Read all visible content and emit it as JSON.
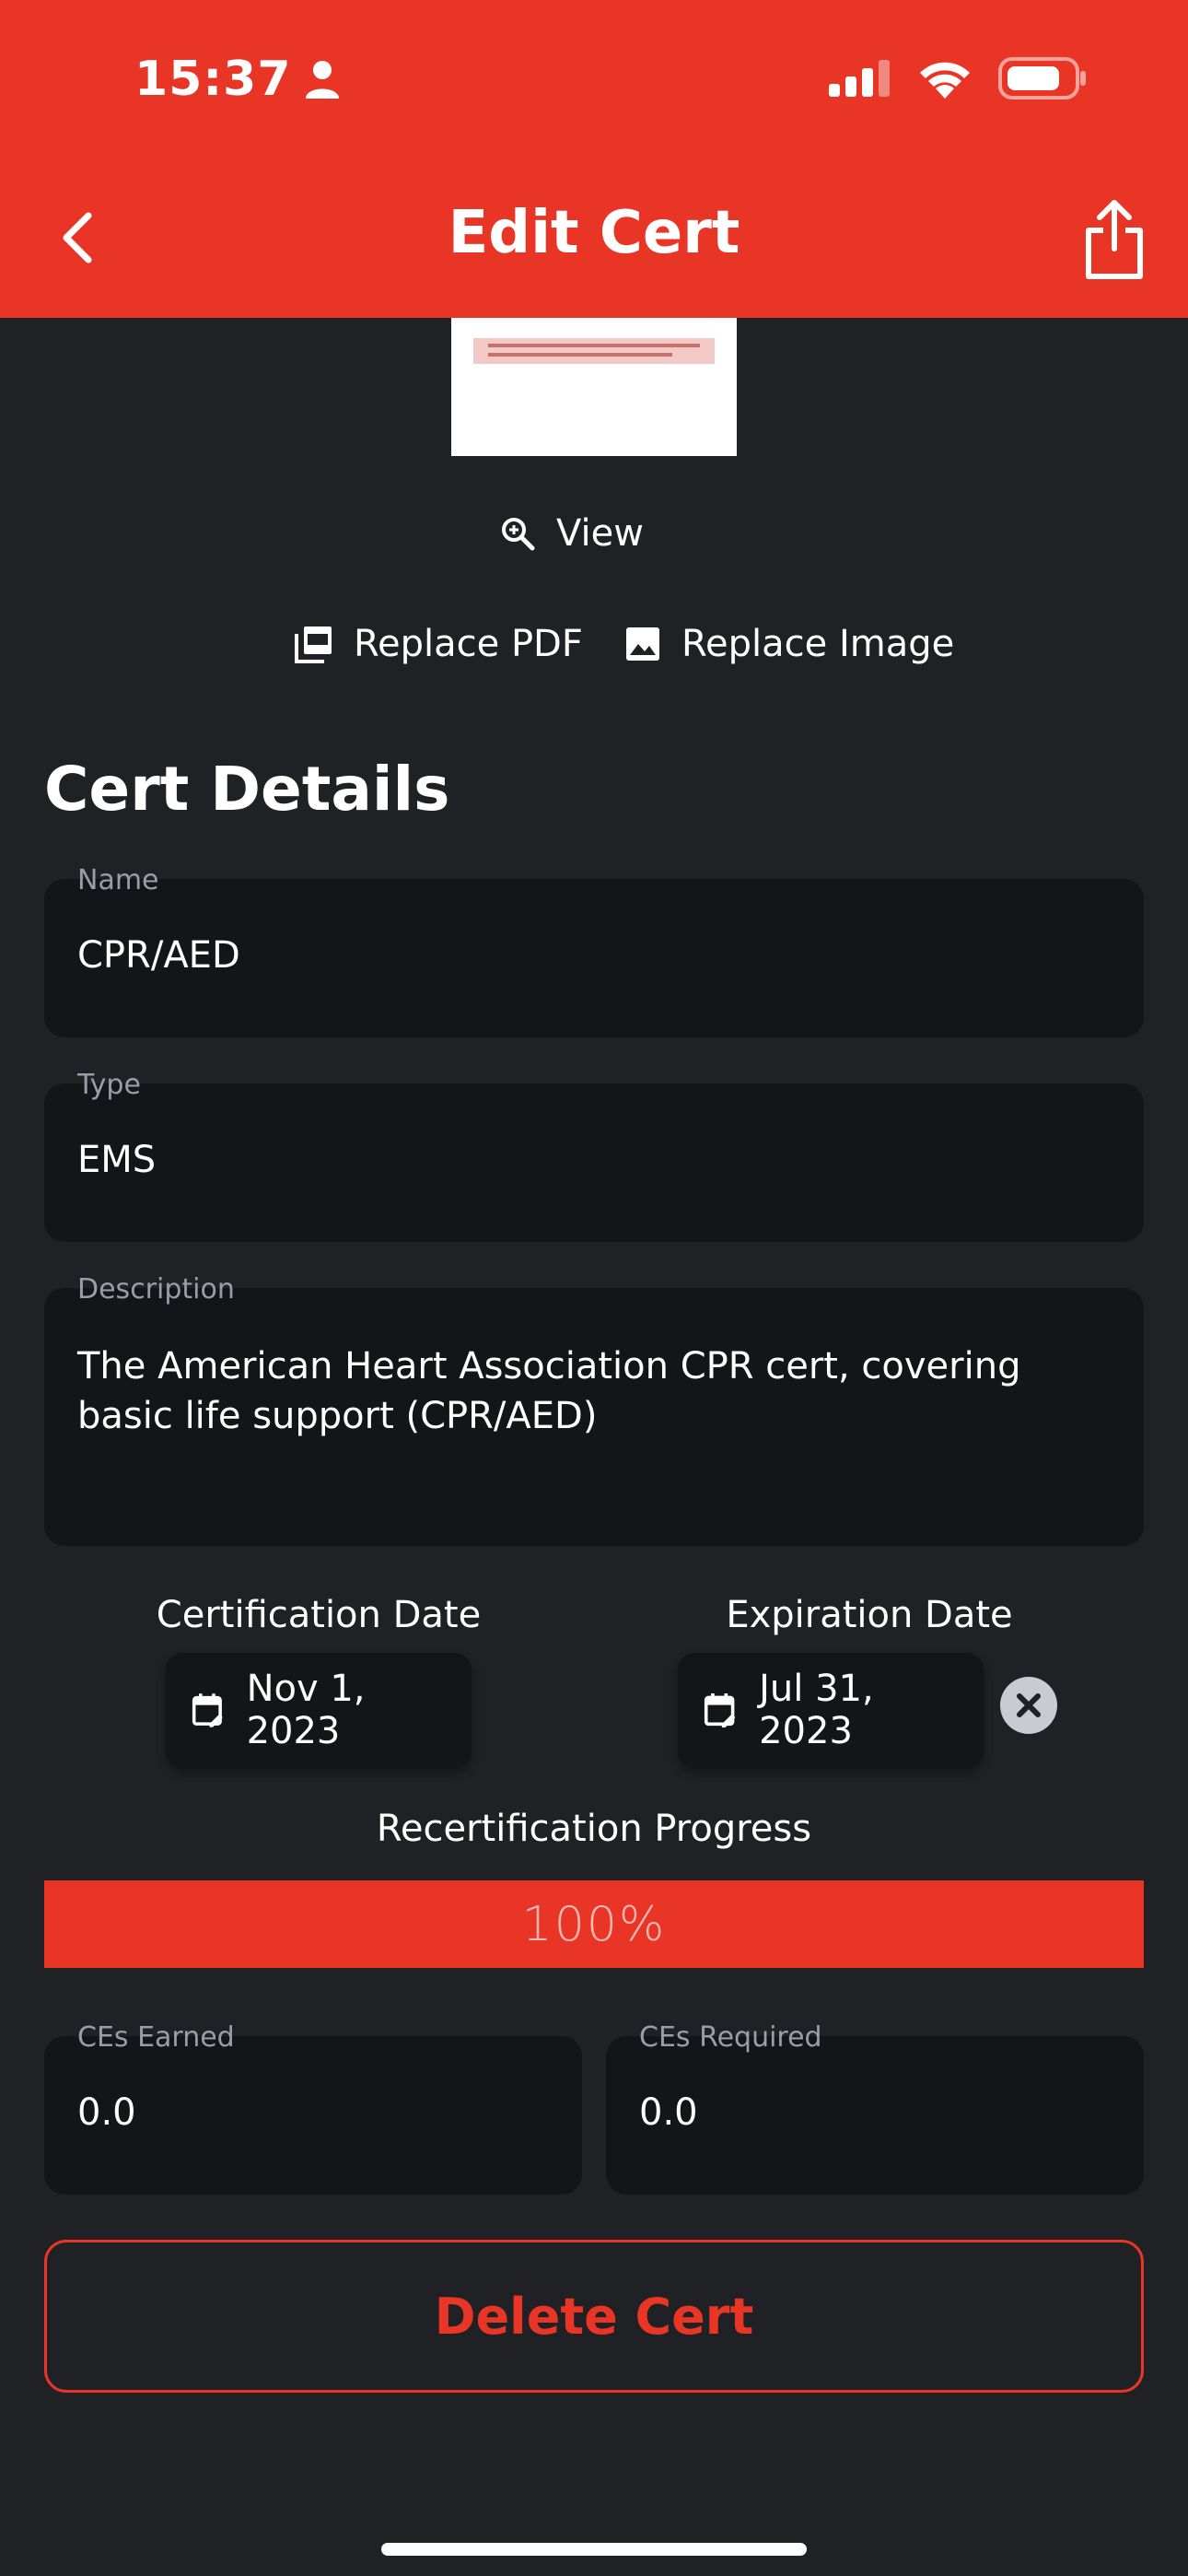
{
  "status_bar": {
    "time": "15:37"
  },
  "header": {
    "title": "Edit Cert"
  },
  "preview": {
    "view_label": "View",
    "replace_pdf_label": "Replace PDF",
    "replace_image_label": "Replace Image"
  },
  "details": {
    "section_title": "Cert Details",
    "name": {
      "label": "Name",
      "value": "CPR/AED"
    },
    "type": {
      "label": "Type",
      "value": "EMS"
    },
    "description": {
      "label": "Description",
      "value": "The American Heart Association CPR cert, covering basic life support (CPR/AED)"
    }
  },
  "dates": {
    "certification": {
      "label": "Certification Date",
      "value": "Nov 1, 2023"
    },
    "expiration": {
      "label": "Expiration Date",
      "value": "Jul 31, 2023"
    }
  },
  "progress": {
    "title": "Recertification Progress",
    "text": "100%",
    "value": 1.0
  },
  "ces": {
    "earned": {
      "label": "CEs Earned",
      "value": "0.0"
    },
    "required": {
      "label": "CEs Required",
      "value": "0.0"
    }
  },
  "delete_label": "Delete Cert",
  "colors": {
    "accent": "#e93526",
    "background": "#1f2125",
    "field": "#141518"
  }
}
